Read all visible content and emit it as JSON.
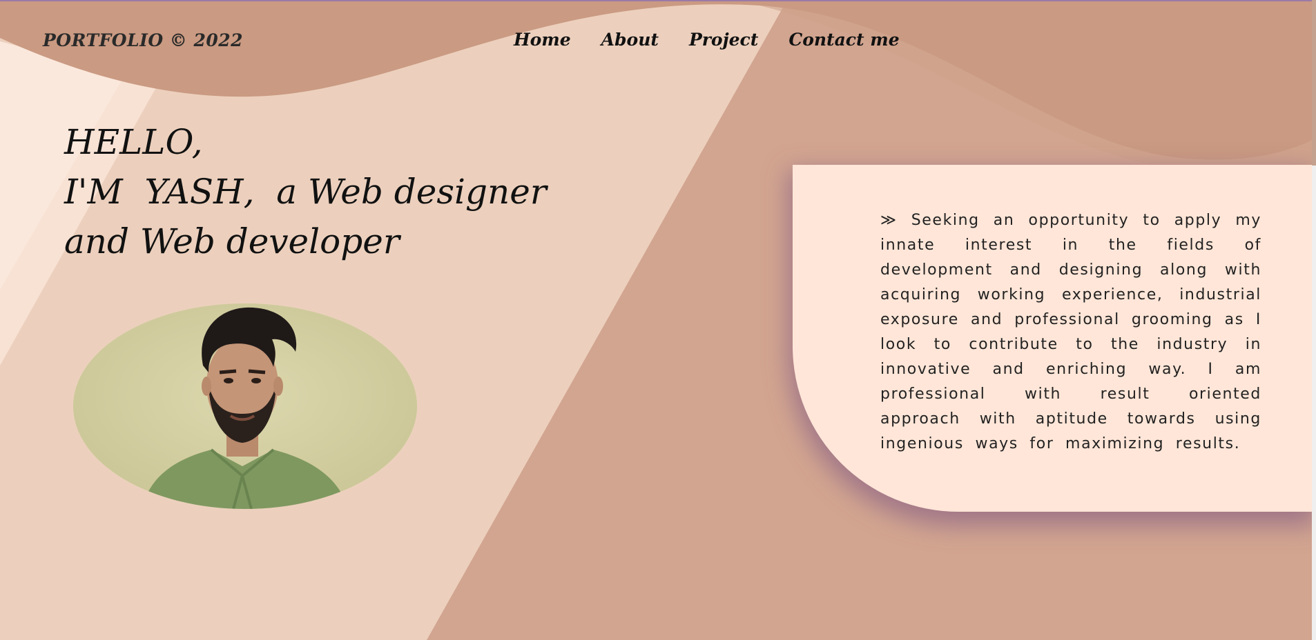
{
  "brand": "PORTFOLIO © 2022",
  "nav": {
    "home": "Home",
    "about": "About",
    "project": "Project",
    "contact": "Contact me"
  },
  "hero": {
    "line1": "HELLO,",
    "line2": "I'M  YASH,  a Web designer",
    "line3": "and Web developer"
  },
  "about": {
    "bullet": "≫",
    "text": "Seeking an opportunity to apply my innate interest in the fields of development and designing along with acquiring working experience, industrial exposure and professional grooming as I look to contribute to the industry in innovative and enriching way. I am professional with result oriented approach with aptitude towards using ingenious ways for maximizing results."
  },
  "colors": {
    "background": "#d2a590",
    "wave": "#ca9a82",
    "light_panel": "#ecd0bd",
    "card": "#ffe6d8"
  }
}
